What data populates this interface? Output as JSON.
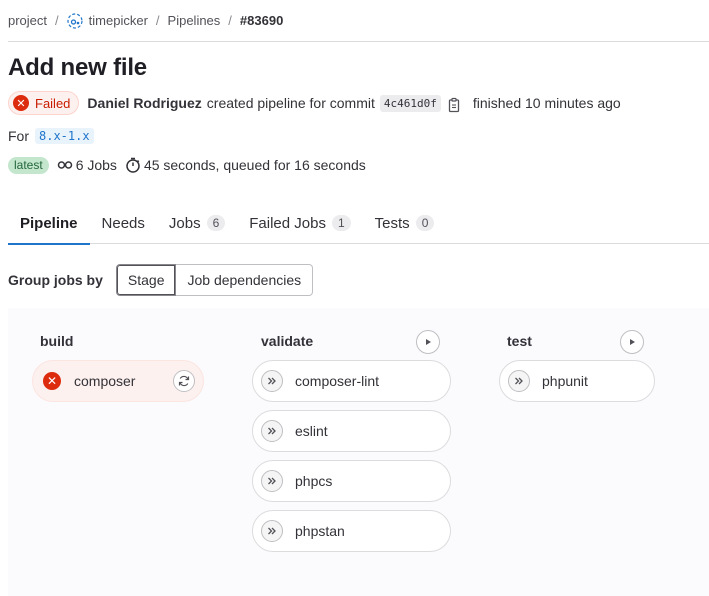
{
  "breadcrumb": {
    "items": [
      "project",
      "timepicker",
      "Pipelines"
    ],
    "current": "#83690"
  },
  "header": {
    "title": "Add new file"
  },
  "pipeline_info": {
    "status": "Failed",
    "author": "Daniel Rodriguez",
    "created_text": "created pipeline for commit",
    "commit_sha": "4c461d0f",
    "finished_text": "finished 10 minutes ago",
    "for_label": "For",
    "branch": "8.x-1.x",
    "latest_badge": "latest",
    "jobs_count": "6 Jobs",
    "duration": "45 seconds, queued for 16 seconds"
  },
  "tabs": [
    {
      "label": "Pipeline",
      "count": null
    },
    {
      "label": "Needs",
      "count": null
    },
    {
      "label": "Jobs",
      "count": "6"
    },
    {
      "label": "Failed Jobs",
      "count": "1"
    },
    {
      "label": "Tests",
      "count": "0"
    }
  ],
  "group_by": {
    "label": "Group jobs by",
    "options": [
      "Stage",
      "Job dependencies"
    ],
    "selected": "Stage"
  },
  "stages": [
    {
      "name": "build",
      "jobs": [
        {
          "name": "composer",
          "status": "failed"
        }
      ]
    },
    {
      "name": "validate",
      "jobs": [
        {
          "name": "composer-lint",
          "status": "skipped"
        },
        {
          "name": "eslint",
          "status": "skipped"
        },
        {
          "name": "phpcs",
          "status": "skipped"
        },
        {
          "name": "phpstan",
          "status": "skipped"
        }
      ]
    },
    {
      "name": "test",
      "jobs": [
        {
          "name": "phpunit",
          "status": "skipped"
        }
      ]
    }
  ],
  "colors": {
    "failed": "#dd2b0e",
    "link_blue": "#1f75cb",
    "latest_bg": "#c3e6cd"
  },
  "icons": [
    "project-logo-icon",
    "copy-icon",
    "pipeline-icon",
    "timer-icon",
    "play-icon",
    "skipped-icon",
    "failed-icon",
    "retry-icon"
  ]
}
